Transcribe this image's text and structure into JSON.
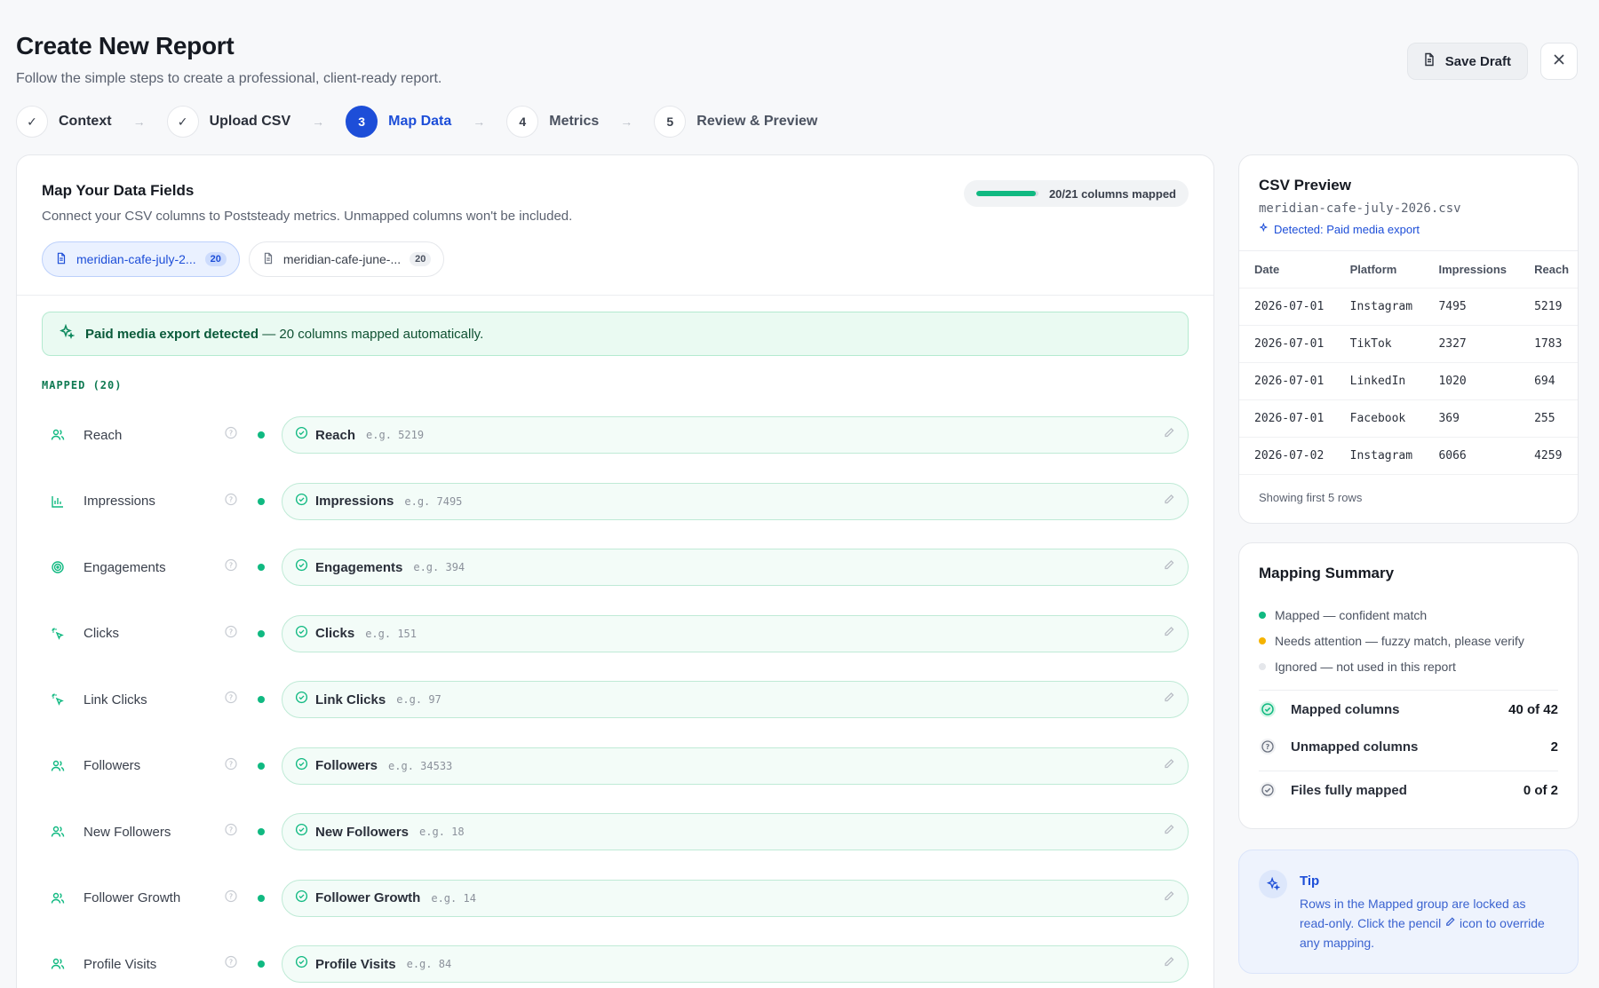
{
  "header": {
    "title": "Create New Report",
    "subtitle": "Follow the simple steps to create a professional, client-ready report.",
    "save_draft_label": "Save Draft"
  },
  "steps": [
    {
      "label": "Context",
      "marker": "✓",
      "state": "done"
    },
    {
      "label": "Upload CSV",
      "marker": "✓",
      "state": "done"
    },
    {
      "label": "Map Data",
      "marker": "3",
      "state": "active"
    },
    {
      "label": "Metrics",
      "marker": "4",
      "state": "pending"
    },
    {
      "label": "Review & Preview",
      "marker": "5",
      "state": "pending"
    }
  ],
  "main": {
    "title": "Map Your Data Fields",
    "subtitle": "Connect your CSV columns to Poststeady metrics. Unmapped columns won't be included.",
    "progress_label": "20/21 columns mapped",
    "progress_fraction": 0.952,
    "file_tabs": [
      {
        "name": "meridian-cafe-july-2...",
        "count": "20",
        "active": true
      },
      {
        "name": "meridian-cafe-june-...",
        "count": "20",
        "active": false
      }
    ],
    "banner_bold": "Paid media export detected",
    "banner_rest": " — 20 columns mapped automatically.",
    "section_label": "MAPPED (20)",
    "rows": [
      {
        "field": "Reach",
        "icon": "users-icon",
        "mapped": "Reach",
        "example": "e.g. 5219"
      },
      {
        "field": "Impressions",
        "icon": "bar-chart-icon",
        "mapped": "Impressions",
        "example": "e.g. 7495"
      },
      {
        "field": "Engagements",
        "icon": "target-icon",
        "mapped": "Engagements",
        "example": "e.g. 394"
      },
      {
        "field": "Clicks",
        "icon": "cursor-click-icon",
        "mapped": "Clicks",
        "example": "e.g. 151"
      },
      {
        "field": "Link Clicks",
        "icon": "cursor-click-icon",
        "mapped": "Link Clicks",
        "example": "e.g. 97"
      },
      {
        "field": "Followers",
        "icon": "users-icon",
        "mapped": "Followers",
        "example": "e.g. 34533"
      },
      {
        "field": "New Followers",
        "icon": "users-icon",
        "mapped": "New Followers",
        "example": "e.g. 18"
      },
      {
        "field": "Follower Growth",
        "icon": "users-icon",
        "mapped": "Follower Growth",
        "example": "e.g. 14"
      },
      {
        "field": "Profile Visits",
        "icon": "users-icon",
        "mapped": "Profile Visits",
        "example": "e.g. 84"
      }
    ]
  },
  "csv_preview": {
    "title": "CSV Preview",
    "filename": "meridian-cafe-july-2026.csv",
    "detected": "Detected: Paid media export",
    "columns": [
      "Date",
      "Platform",
      "Impressions",
      "Reach"
    ],
    "rows": [
      [
        "2026-07-01",
        "Instagram",
        "7495",
        "5219"
      ],
      [
        "2026-07-01",
        "TikTok",
        "2327",
        "1783"
      ],
      [
        "2026-07-01",
        "LinkedIn",
        "1020",
        "694"
      ],
      [
        "2026-07-01",
        "Facebook",
        "369",
        "255"
      ],
      [
        "2026-07-02",
        "Instagram",
        "6066",
        "4259"
      ]
    ],
    "footer": "Showing first 5 rows"
  },
  "summary": {
    "title": "Mapping Summary",
    "legend": [
      {
        "label": "Mapped — confident match",
        "color": "#10b981"
      },
      {
        "label": "Needs attention — fuzzy match, please verify",
        "color": "#f5b301"
      },
      {
        "label": "Ignored — not used in this report",
        "color": "#e5e7eb"
      }
    ],
    "stats": [
      {
        "label": "Mapped columns",
        "value": "40 of 42"
      },
      {
        "label": "Unmapped columns",
        "value": "2"
      },
      {
        "label": "Files fully mapped",
        "value": "0 of 2"
      }
    ]
  },
  "tip": {
    "title": "Tip",
    "text_before": "Rows in the Mapped group are locked as read-only. Click the pencil ",
    "text_after": " icon to override any mapping."
  },
  "colors": {
    "accent": "#1d4ed8",
    "mapped": "#10b981"
  }
}
